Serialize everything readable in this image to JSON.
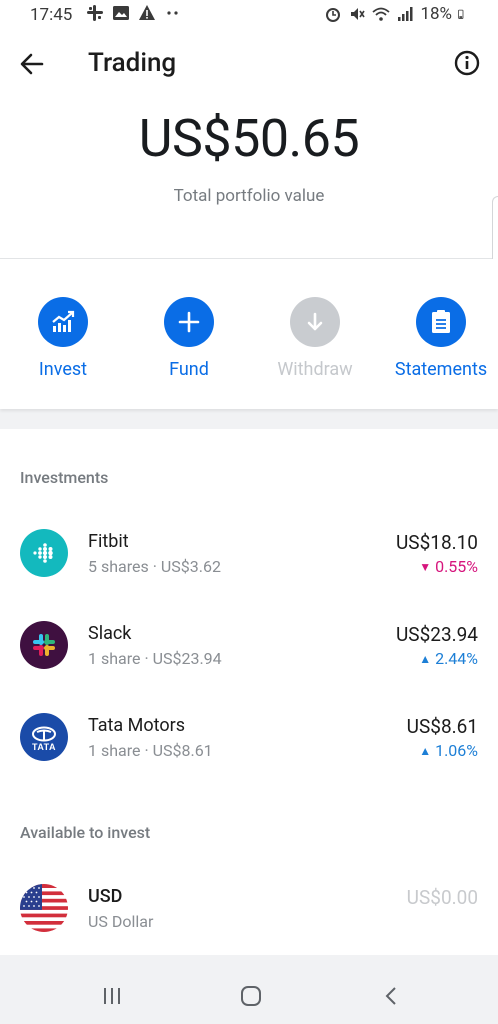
{
  "status_bar": {
    "time": "17:45",
    "battery": "18%",
    "left_icons": [
      "slack-notification-icon",
      "image-notification-icon",
      "warning-icon",
      "more-dots-icon"
    ],
    "right_icons": [
      "alarm-icon",
      "mute-icon",
      "wifi-icon",
      "signal-icon",
      "battery-icon"
    ]
  },
  "app_bar": {
    "title": "Trading"
  },
  "portfolio": {
    "value": "US$50.65",
    "label": "Total portfolio value"
  },
  "actions": [
    {
      "label": "Invest",
      "icon": "chart-up-icon",
      "enabled": true
    },
    {
      "label": "Fund",
      "icon": "plus-icon",
      "enabled": true
    },
    {
      "label": "Withdraw",
      "icon": "arrow-down-icon",
      "enabled": false
    },
    {
      "label": "Statements",
      "icon": "document-icon",
      "enabled": true
    }
  ],
  "investments": {
    "title": "Investments",
    "items": [
      {
        "name": "Fitbit",
        "sub": "5 shares · US$3.62",
        "value": "US$18.10",
        "change": "0.55%",
        "direction": "down",
        "logo": "fitbit-logo"
      },
      {
        "name": "Slack",
        "sub": "1 share · US$23.94",
        "value": "US$23.94",
        "change": "2.44%",
        "direction": "up",
        "logo": "slack-logo"
      },
      {
        "name": "Tata Motors",
        "sub": "1 share · US$8.61",
        "value": "US$8.61",
        "change": "1.06%",
        "direction": "up",
        "logo": "tata-logo"
      }
    ]
  },
  "available": {
    "title": "Available to invest",
    "items": [
      {
        "name": "USD",
        "sub": "US Dollar",
        "value": "US$0.00",
        "logo": "us-flag"
      }
    ]
  },
  "tata_logo_text": "TATA",
  "colors": {
    "accent": "#0a6de6",
    "negative": "#d6157d",
    "positive": "#1d7fd6"
  }
}
